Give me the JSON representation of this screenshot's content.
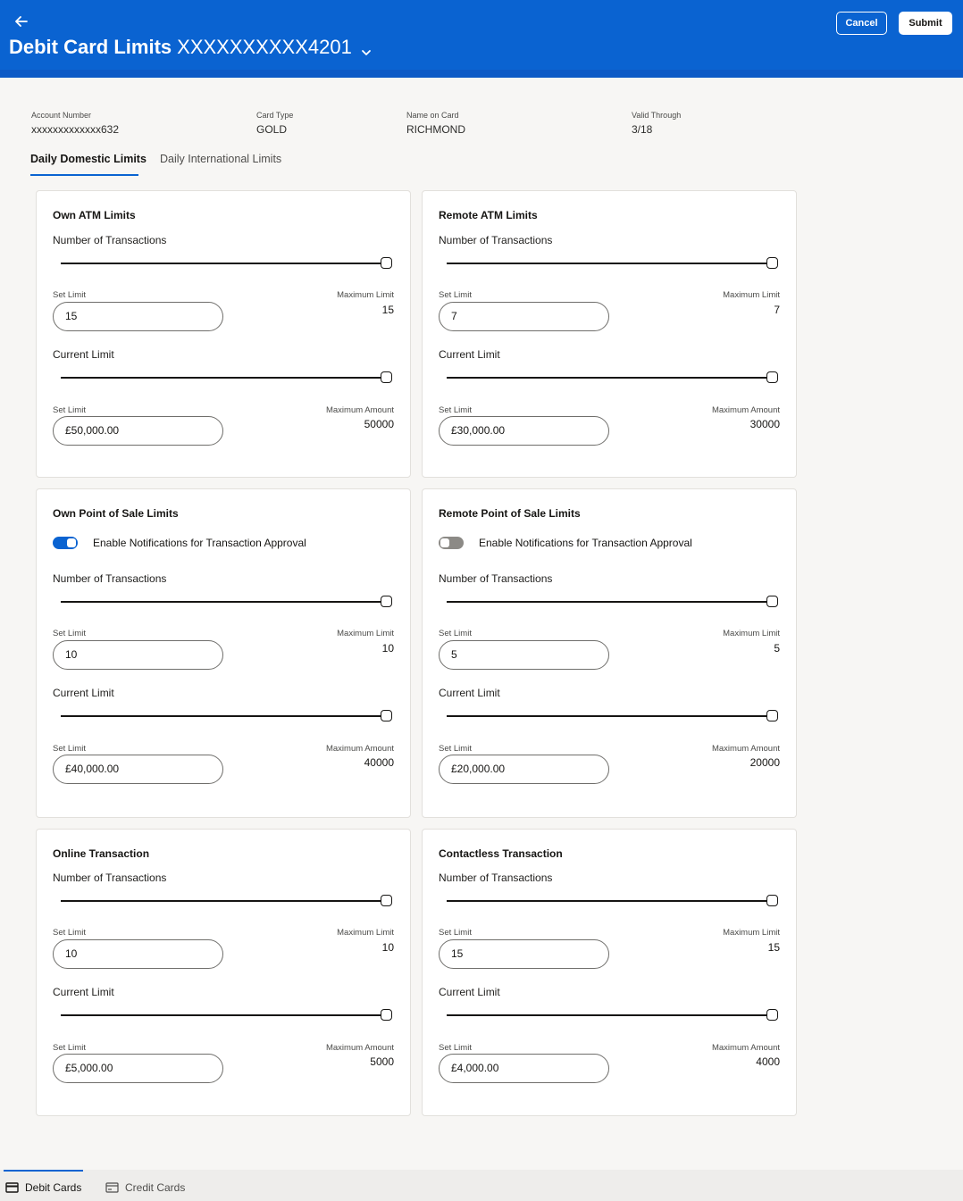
{
  "header": {
    "title_bold": "Debit Card Limits",
    "title_number": "XXXXXXXXXX4201",
    "cancel_label": "Cancel",
    "submit_label": "Submit"
  },
  "account_info": {
    "account_number_label": "Account Number",
    "account_number_value": "xxxxxxxxxxxxx632",
    "card_type_label": "Card Type",
    "card_type_value": "GOLD",
    "name_on_card_label": "Name on Card",
    "name_on_card_value": "RICHMOND",
    "valid_through_label": "Valid Through",
    "valid_through_value": "3/18"
  },
  "tabs": {
    "domestic": "Daily Domestic Limits",
    "international": "Daily International Limits"
  },
  "common": {
    "number_of_transactions": "Number of Transactions",
    "current_limit": "Current Limit",
    "set_limit": "Set Limit",
    "maximum_limit": "Maximum Limit",
    "maximum_amount": "Maximum Amount",
    "notification_label": "Enable Notifications for Transaction Approval"
  },
  "cards": {
    "own_atm": {
      "title": "Own ATM Limits",
      "count_set": "15",
      "count_max": "15",
      "amount_set": "£50,000.00",
      "amount_max": "50000"
    },
    "remote_atm": {
      "title": "Remote ATM Limits",
      "count_set": "7",
      "count_max": "7",
      "amount_set": "£30,000.00",
      "amount_max": "30000"
    },
    "own_pos": {
      "title": "Own Point of Sale Limits",
      "notifications_enabled": true,
      "count_set": "10",
      "count_max": "10",
      "amount_set": "£40,000.00",
      "amount_max": "40000"
    },
    "remote_pos": {
      "title": "Remote Point of Sale Limits",
      "notifications_enabled": false,
      "count_set": "5",
      "count_max": "5",
      "amount_set": "£20,000.00",
      "amount_max": "20000"
    },
    "online": {
      "title": "Online Transaction",
      "count_set": "10",
      "count_max": "10",
      "amount_set": "£5,000.00",
      "amount_max": "5000"
    },
    "contactless": {
      "title": "Contactless Transaction",
      "count_set": "15",
      "count_max": "15",
      "amount_set": "£4,000.00",
      "amount_max": "4000"
    }
  },
  "bottom_nav": {
    "debit_cards": "Debit Cards",
    "credit_cards": "Credit Cards"
  },
  "colors": {
    "brand_blue": "#0a63d1",
    "toggle_off": "#8c8a86"
  }
}
